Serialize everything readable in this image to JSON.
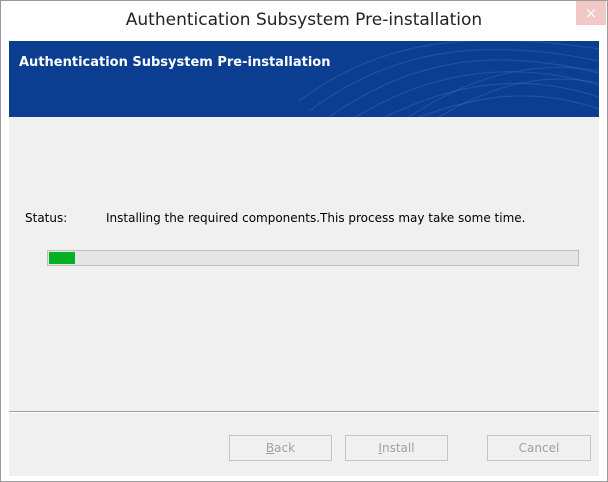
{
  "window": {
    "title": "Authentication Subsystem Pre-installation",
    "close_glyph": "×"
  },
  "banner": {
    "title": "Authentication Subsystem Pre-installation",
    "background_color": "#0b3d91"
  },
  "status": {
    "label": "Status:",
    "message": "Installing the required components.This process may take some time."
  },
  "progress": {
    "value_fraction": 0.05,
    "fill_color": "#06b025"
  },
  "buttons": {
    "back": {
      "mnemonic": "B",
      "rest": "ack",
      "enabled": false
    },
    "install": {
      "mnemonic": "I",
      "rest": "nstall",
      "enabled": false
    },
    "cancel": {
      "label": "Cancel",
      "enabled": false
    }
  }
}
